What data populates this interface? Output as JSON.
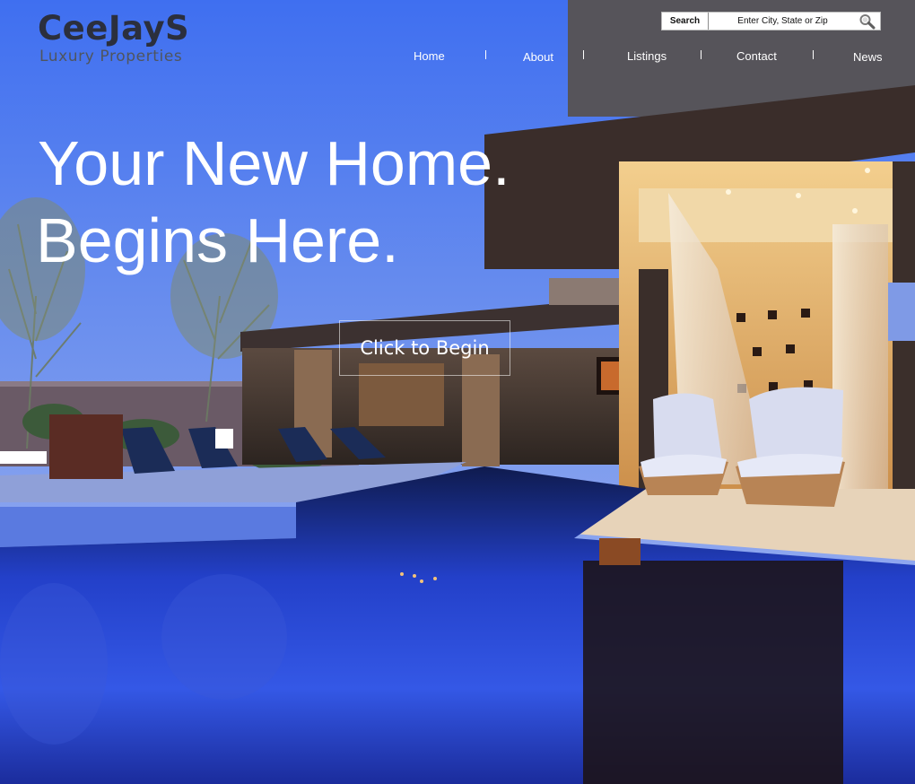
{
  "brand": {
    "name": "CeeJayS",
    "tagline": "Luxury Properties"
  },
  "search": {
    "button_label": "Search",
    "placeholder": "Enter City, State or Zip",
    "icon": "magnifier-icon"
  },
  "nav": {
    "items": [
      {
        "label": "Home"
      },
      {
        "label": "About"
      },
      {
        "label": "Listings"
      },
      {
        "label": "Contact"
      },
      {
        "label": "News"
      }
    ]
  },
  "hero": {
    "line1": "Your New Home.",
    "line2": "Begins Here.",
    "cta_label": "Click to Begin"
  },
  "colors": {
    "logo_text": "#2b2f3d",
    "tagline_text": "#4f555e",
    "sky": "#5f86ee",
    "pool": "#2a4bd6",
    "interior_light": "#e6b26a",
    "text_on_image": "#ffffff"
  }
}
